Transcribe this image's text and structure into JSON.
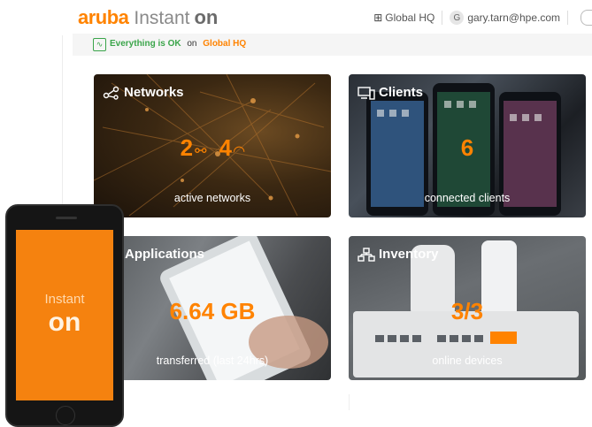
{
  "header": {
    "brand_aruba": "aruba",
    "brand_instant": "Instant",
    "brand_on": "on",
    "site_label": "Global HQ",
    "user_initial": "G",
    "user_email": "gary.tarn@hpe.com"
  },
  "status": {
    "ok_text": "Everything is OK",
    "on_text": "on",
    "site": "Global HQ",
    "ok_color": "#3aa54a",
    "accent_color": "#ff8300"
  },
  "cards": {
    "networks": {
      "title": "Networks",
      "wired_count": "2",
      "wireless_count": "4",
      "subtitle": "active networks"
    },
    "clients": {
      "title": "Clients",
      "count": "6",
      "subtitle": "connected clients"
    },
    "applications": {
      "title": "Applications",
      "value": "6.64 GB",
      "subtitle": "transferred (last 24hrs)"
    },
    "inventory": {
      "title": "Inventory",
      "value": "3/3",
      "subtitle": "online devices"
    }
  },
  "phone_overlay": {
    "line1": "Instant",
    "line2": "on"
  }
}
